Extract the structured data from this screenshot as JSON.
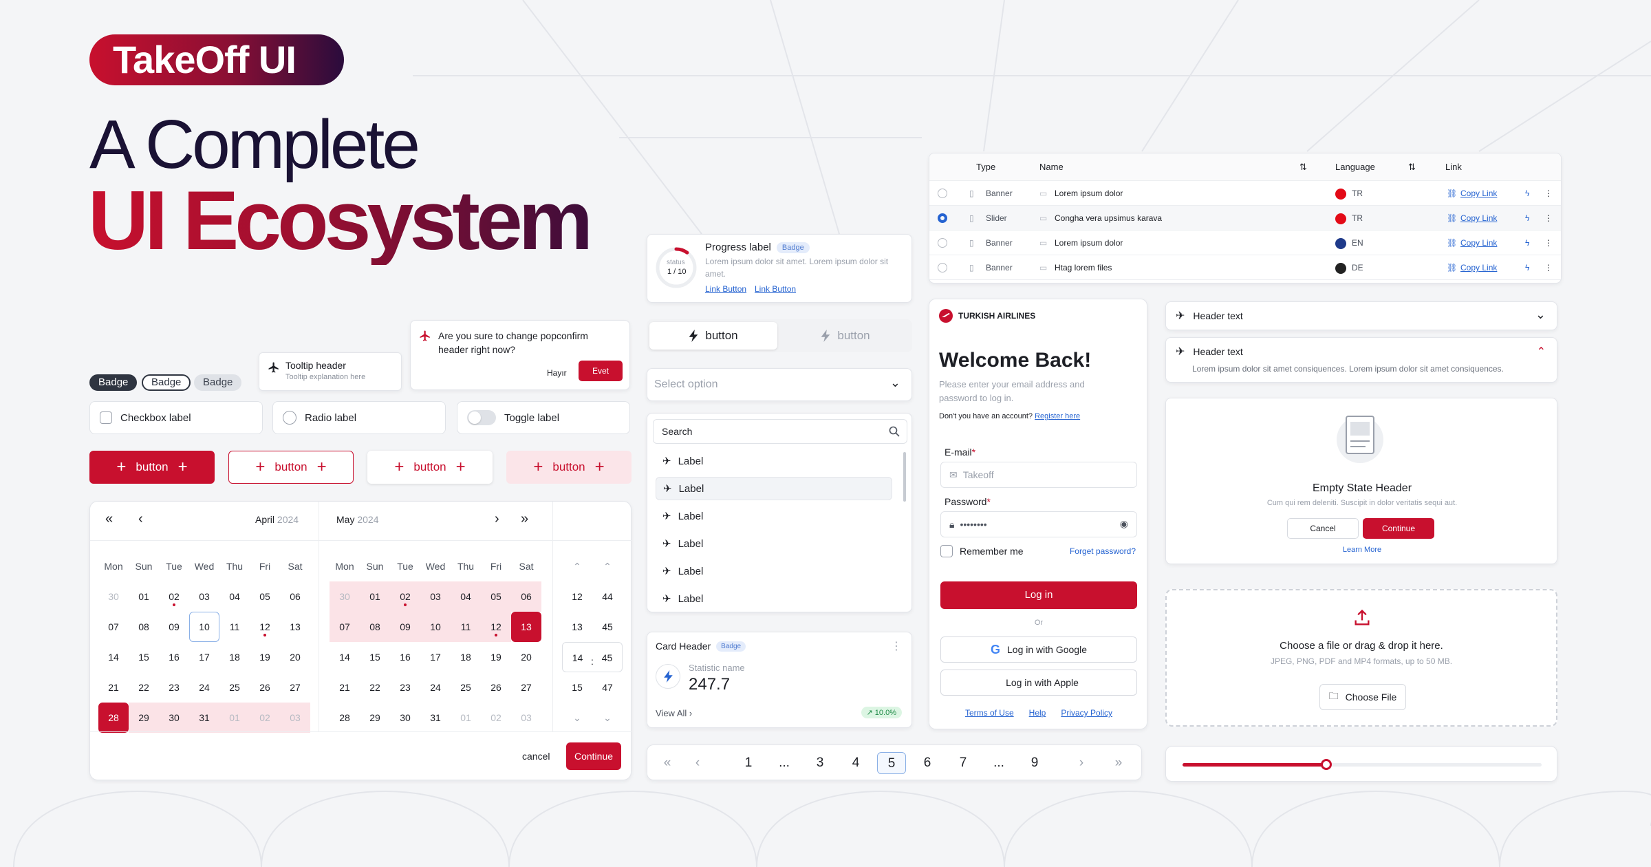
{
  "brand": {
    "logo_text": "TakeOff UI",
    "title_line1": "A Complete",
    "title_line2": "UI Ecosystem",
    "accent": "#c8102e",
    "dark": "#1a1234"
  },
  "badges": [
    "Badge",
    "Badge",
    "Badge"
  ],
  "tooltip": {
    "header": "Tooltip header",
    "explanation": "Tooltip explanation here"
  },
  "popconfirm": {
    "text": "Are you sure to change popconfirm header right now?",
    "no": "Hayır",
    "yes": "Evet"
  },
  "controls": {
    "checkbox": "Checkbox label",
    "radio": "Radio label",
    "toggle": "Toggle label"
  },
  "buttons": {
    "label": "button"
  },
  "calendar": {
    "left_month": "April",
    "left_year": "2024",
    "right_month": "May",
    "right_year": "2024",
    "weekdays": [
      "Mon",
      "Tue",
      "Wed",
      "Thu",
      "Fri",
      "Sat",
      "Sun"
    ],
    "weekdays_shown": [
      "Mon",
      "Sun",
      "Tue",
      "Wed",
      "Thu",
      "Fri",
      "Sat"
    ],
    "april": [
      [
        "30",
        "01",
        "02",
        "03",
        "04",
        "05",
        "06"
      ],
      [
        "07",
        "08",
        "09",
        "10",
        "11",
        "12",
        "13"
      ],
      [
        "14",
        "15",
        "16",
        "17",
        "18",
        "19",
        "20"
      ],
      [
        "21",
        "22",
        "23",
        "24",
        "25",
        "26",
        "27"
      ],
      [
        "28",
        "29",
        "30",
        "31",
        "01",
        "02",
        "03"
      ]
    ],
    "may": [
      [
        "30",
        "01",
        "02",
        "03",
        "04",
        "05",
        "06"
      ],
      [
        "07",
        "08",
        "09",
        "10",
        "11",
        "12",
        "13"
      ],
      [
        "14",
        "15",
        "16",
        "17",
        "18",
        "19",
        "20"
      ],
      [
        "21",
        "22",
        "23",
        "24",
        "25",
        "26",
        "27"
      ],
      [
        "28",
        "29",
        "30",
        "31",
        "01",
        "02",
        "03"
      ]
    ],
    "hours": [
      "12",
      "13",
      "14",
      "15"
    ],
    "minutes": [
      "44",
      "45",
      "45",
      "47"
    ],
    "time_sep": ":",
    "cancel": "cancel",
    "continue": "Continue"
  },
  "progress": {
    "label": "Progress label",
    "badge": "Badge",
    "text": "Lorem ipsum dolor sit amet. Lorem ipsum dolor sit amet.",
    "status_label": "status",
    "status_value": "1 / 10",
    "link1": "Link Button",
    "link2": "Link Button",
    "value": 0.1
  },
  "segmented": {
    "item1": "button",
    "item2": "button"
  },
  "select": {
    "placeholder": "Select option"
  },
  "list": {
    "search_placeholder": "Search",
    "items": [
      "Label",
      "Label",
      "Label",
      "Label",
      "Label",
      "Label"
    ]
  },
  "card": {
    "header": "Card Header",
    "badge": "Badge",
    "stat_name": "Statistic name",
    "stat_value": "247.7",
    "view_all": "View All",
    "trend": "10.0%"
  },
  "pagination": {
    "pages": [
      "1",
      "...",
      "3",
      "4",
      "5",
      "6",
      "7",
      "...",
      "9"
    ],
    "current": "5"
  },
  "table": {
    "headers": {
      "type": "Type",
      "name": "Name",
      "language": "Language",
      "link": "Link"
    },
    "rows": [
      {
        "type": "Banner",
        "name": "Lorem ipsum dolor",
        "lang": "TR",
        "link": "Copy Link",
        "selected": false
      },
      {
        "type": "Slider",
        "name": "Congha vera upsimus karava",
        "lang": "TR",
        "link": "Copy Link",
        "selected": true
      },
      {
        "type": "Banner",
        "name": "Lorem ipsum dolor",
        "lang": "EN",
        "link": "Copy Link",
        "selected": false
      },
      {
        "type": "Banner",
        "name": "Htag lorem files",
        "lang": "DE",
        "link": "Copy Link",
        "selected": false
      }
    ]
  },
  "login": {
    "airline": "TURKISH AIRLINES",
    "title": "Welcome Back!",
    "subtitle": "Please enter your email address and password to log in.",
    "no_account": "Don't you have an account?",
    "register": "Register here",
    "email_label": "E-mail",
    "email_placeholder": "Takeoff",
    "password_label": "Password",
    "password_value": "••••••••",
    "remember": "Remember me",
    "forgot": "Forget password?",
    "login_btn": "Log in",
    "or": "Or",
    "google": "Log in with Google",
    "apple": "Log in with Apple",
    "terms": "Terms of Use",
    "help": "Help",
    "privacy": "Privacy Policy"
  },
  "accordion": {
    "header1": "Header text",
    "header2": "Header text",
    "body2": "Lorem ipsum dolor sit amet consiquences. Lorem ipsum dolor sit amet consiquences."
  },
  "empty_state": {
    "header": "Empty State Header",
    "text": "Cum qui rem deleniti. Suscipit in dolor veritatis sequi aut.",
    "cancel": "Cancel",
    "continue": "Continue",
    "learn": "Learn More"
  },
  "upload": {
    "title": "Choose a file or drag & drop it here.",
    "formats": "JPEG, PNG, PDF and MP4 formats, up to 50 MB.",
    "button": "Choose File"
  },
  "slider": {
    "value": 0.4
  }
}
